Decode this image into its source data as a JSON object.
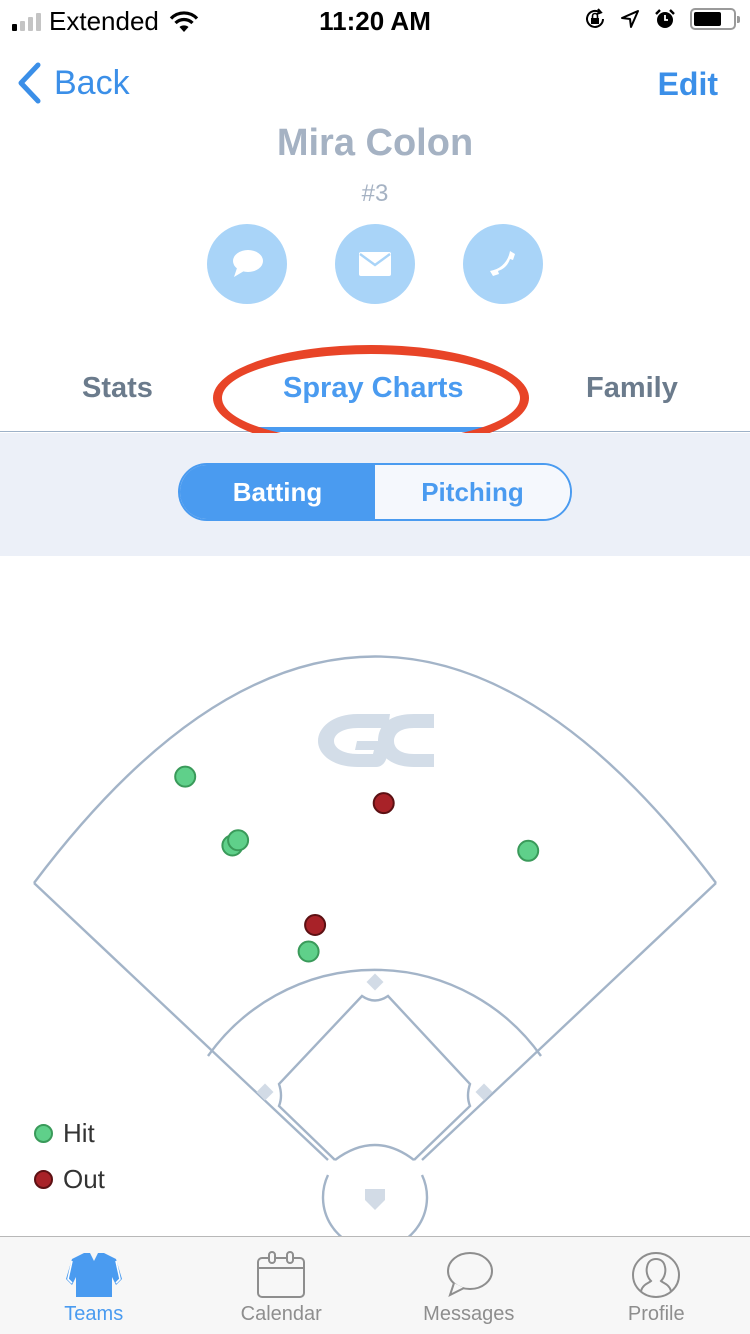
{
  "status_bar": {
    "carrier": "Extended",
    "time": "11:20 AM",
    "signal_bars_on": 1,
    "signal_bars_total": 4,
    "battery_level": 0.75,
    "icons": [
      "signal-icon",
      "wifi-icon",
      "orientation-lock-icon",
      "location-arrow-icon",
      "alarm-icon",
      "battery-icon"
    ]
  },
  "nav": {
    "back_label": "Back",
    "edit_label": "Edit"
  },
  "player": {
    "name": "Mira Colon",
    "number": "#3"
  },
  "contact_actions": [
    {
      "icon": "chat-bubble-icon",
      "name": "message"
    },
    {
      "icon": "envelope-icon",
      "name": "email"
    },
    {
      "icon": "phone-icon",
      "name": "call"
    }
  ],
  "tabs": [
    {
      "label": "Stats",
      "active": false
    },
    {
      "label": "Spray Charts",
      "active": true
    },
    {
      "label": "Family",
      "active": false
    }
  ],
  "segment": {
    "options": [
      "Batting",
      "Pitching"
    ],
    "selected": "Batting"
  },
  "colors": {
    "accent": "#4a9bf0",
    "hit_fill": "#5fd08a",
    "hit_stroke": "#3a9a5a",
    "out_fill": "#a82228",
    "out_stroke": "#5c1013",
    "field_line": "#a3b4c8",
    "annotation": "#e84427"
  },
  "chart_data": {
    "type": "scatter",
    "title": "Spray Chart",
    "watermark": "GC",
    "legend": [
      {
        "label": "Hit",
        "type": "hit"
      },
      {
        "label": "Out",
        "type": "out"
      }
    ],
    "legend_position": "bottom-left",
    "coordinate_note": "x: -1 (left foul line) to 1 (right foul line) normalized horizontal; depth: 0 (home) to 1 (outfield fence)",
    "points": [
      {
        "type": "hit",
        "x": -0.61,
        "depth": 0.78
      },
      {
        "type": "hit",
        "x": -0.55,
        "depth": 0.65
      },
      {
        "type": "hit",
        "x": -0.52,
        "depth": 0.66
      },
      {
        "type": "hit",
        "x": -0.37,
        "depth": 0.45
      },
      {
        "type": "hit",
        "x": 0.6,
        "depth": 0.64
      },
      {
        "type": "out",
        "x": 0.03,
        "depth": 0.73
      },
      {
        "type": "out",
        "x": -0.3,
        "depth": 0.5
      }
    ]
  },
  "bottom_tabs": [
    {
      "label": "Teams",
      "icon": "jersey-icon",
      "active": true
    },
    {
      "label": "Calendar",
      "icon": "calendar-icon",
      "active": false
    },
    {
      "label": "Messages",
      "icon": "speech-bubble-icon",
      "active": false
    },
    {
      "label": "Profile",
      "icon": "profile-icon",
      "active": false
    }
  ]
}
